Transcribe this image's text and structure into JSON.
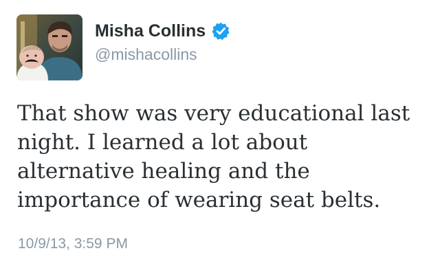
{
  "user": {
    "display_name": "Misha Collins",
    "handle": "@mishacollins",
    "verified": true,
    "verified_icon": "verified-badge-icon",
    "avatar_icon": "profile-photo"
  },
  "tweet": {
    "lines": [
      "That show was very educational last",
      "night. I learned a lot about",
      "alternative healing and the",
      "importance of wearing seat belts."
    ],
    "timestamp": "10/9/13, 3:59 PM"
  },
  "colors": {
    "text": "#292f33",
    "muted": "#8899a6",
    "verified": "#1da1f2"
  }
}
